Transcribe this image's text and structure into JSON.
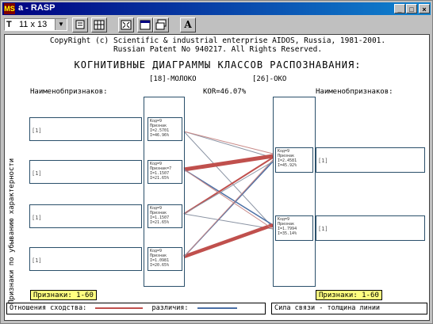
{
  "window": {
    "title": "a - RASP",
    "app_icon_text": "MS",
    "controls": [
      "_",
      "□",
      "×"
    ]
  },
  "toolbar": {
    "font_size": "11 x 13",
    "tools": [
      "copy-icon",
      "grid-icon",
      "fullscreen-icon",
      "window-icon",
      "window2-icon"
    ],
    "font_button_label": "A"
  },
  "header": {
    "copyright": "CopyRight (c) Scientific & industrial enterprise AIDOS, Russia, 1981-2001.",
    "patent": "Russian Patent No 940217. All Rights Reserved.",
    "title": "КОГНИТИВНЫЕ ДИАГРАММЫ КЛАССОВ РАСПОЗНАВАНИЯ:"
  },
  "diagram": {
    "left_class": "[18]-МОЛОКО",
    "right_class": "[26]-ОКО",
    "kor": "KOR=46.07%",
    "left_features_label": "Наименобпризнаков:",
    "right_features_label": "Наименобпризнаков:",
    "vertical_label": "Признаки по убыванию характерности",
    "left_name_boxes": [
      "[1]",
      "[1]",
      "[1]",
      "[1]"
    ],
    "right_name_boxes": [
      "[1]",
      "[1]"
    ],
    "left_feature_boxes": [
      [
        "Код=9",
        "Признак",
        "I=2.5701",
        "I=46.96%"
      ],
      [
        "Код=9",
        "Признак=7",
        "I=1.1507",
        "I=21.65%"
      ],
      [
        "Код=9",
        "Признак",
        "I=1.1507",
        "I=21.65%"
      ],
      [
        "Код=9",
        "Признак",
        "I=1.0981",
        "I=20.65%"
      ]
    ],
    "right_feature_boxes": [
      [
        "Код=9",
        "Признак",
        "I=2.4581",
        "I=45.92%"
      ],
      [
        "Код=9",
        "Признак",
        "I=1.7994",
        "I=35.14%"
      ]
    ],
    "left_badge": "Признаки: 1-60",
    "right_badge": "Признаки: 1-60",
    "legend_left": "Отношения сходства:",
    "legend_mid": "различия:",
    "legend_right": "Сила связи - толщина линии"
  },
  "colors": {
    "similarity": "#c0504d",
    "difference": "#4a6fa5",
    "badge": "#ffff80"
  }
}
